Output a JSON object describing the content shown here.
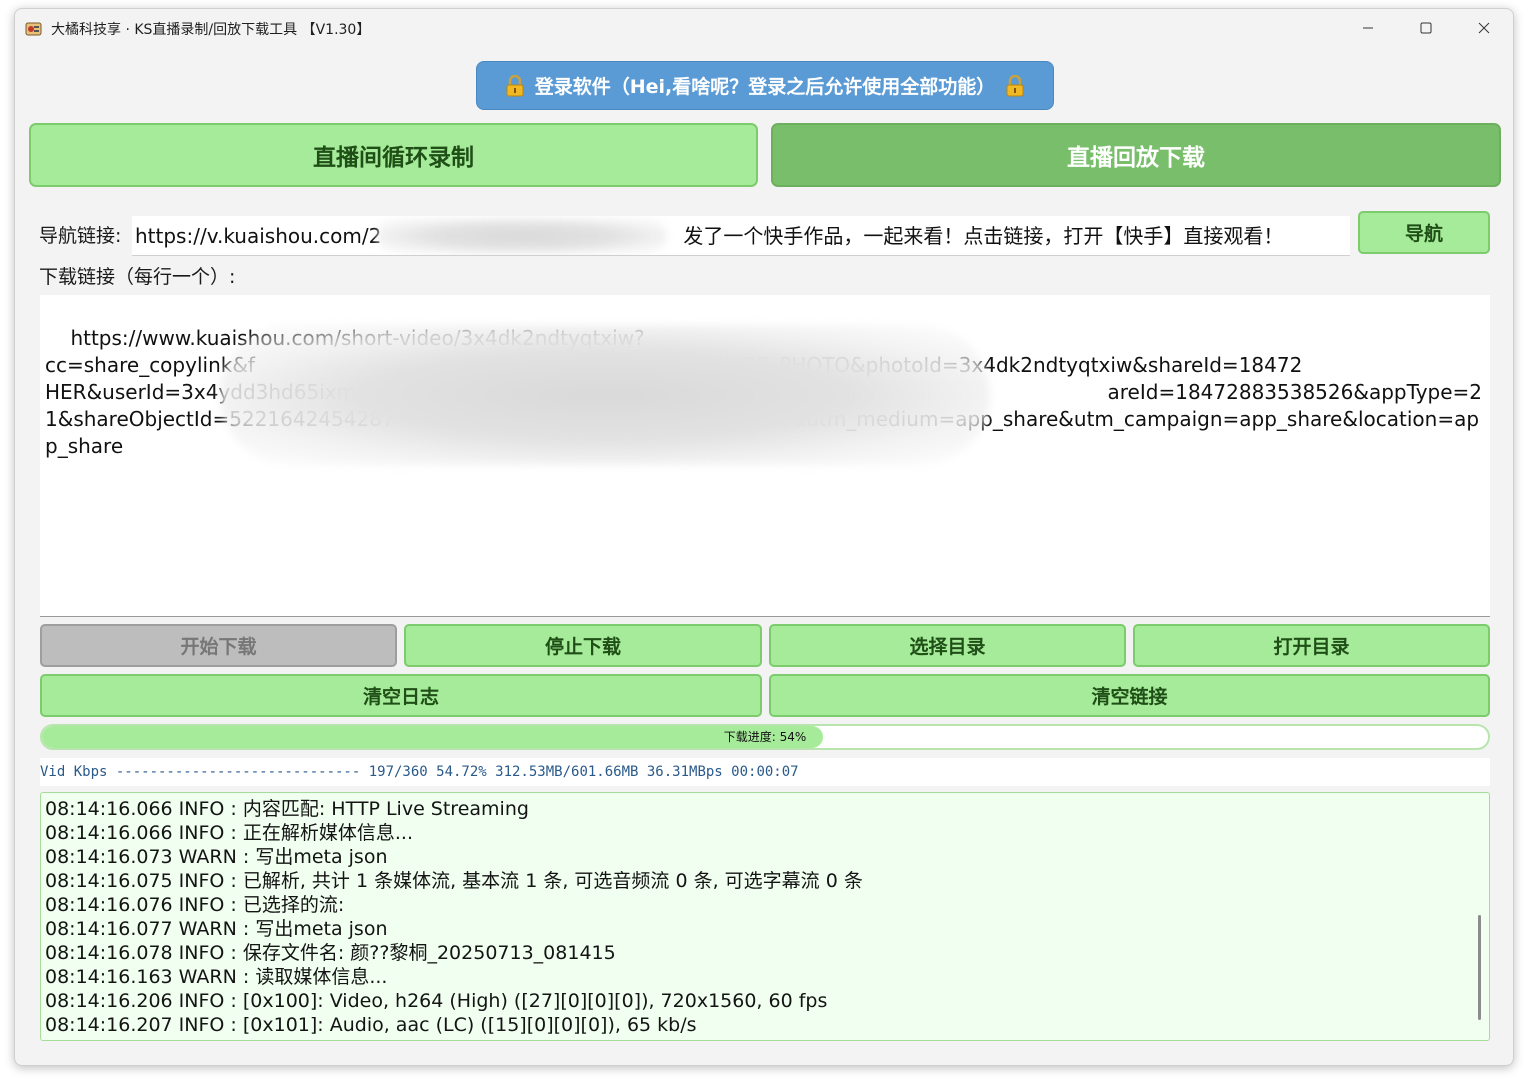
{
  "window": {
    "title": "大橘科技享 · KS直播录制/回放下载工具 【V1.30】"
  },
  "login": {
    "label": "登录软件（Hei,看啥呢？登录之后允许使用全部功能）"
  },
  "tabs": [
    {
      "label": "直播间循环录制"
    },
    {
      "label": "直播回放下载"
    }
  ],
  "nav": {
    "label": "导航链接:",
    "value_prefix": "https://v.kuaishou.com/2",
    "value_suffix": "发了一个快手作品，一起来看！点击链接，打开【快手】直接观看！",
    "button": "导航"
  },
  "download": {
    "label": "下载链接（每行一个）:",
    "links": "https://www.kuaishou.com/short-video/3x4dk2ndtyqtxiw?\ncc=share_copylink&f                                                 Biz=BROWSE_SLIDE_PHOTO&photoId=3x4dk2ndtyqtxiw&shareId=18472                                                   HER&userId=3x4ydd3hd65ixms&shareType=1&et=1_i%252F20047764 1                                                   areId=18472883538526&appType=21&shareObjectId=5221642454287                                                  p_share&utm_medium=app_share&utm_campaign=app_share&location=app_share"
  },
  "buttons": {
    "start": "开始下载",
    "stop": "停止下载",
    "choose_dir": "选择目录",
    "open_dir": "打开目录",
    "clear_log": "清空日志",
    "clear_links": "清空链接"
  },
  "progress": {
    "value": 54,
    "label": "下载进度: 54%"
  },
  "status_line": "Vid Kbps ----------------------------- 197/360 54.72% 312.53MB/601.66MB 36.31MBps 00:00:07",
  "log": {
    "lines": [
      "08:14:16.066 INFO : 内容匹配: HTTP Live Streaming",
      "08:14:16.066 INFO : 正在解析媒体信息...",
      "08:14:16.073 WARN : 写出meta json",
      "08:14:16.075 INFO : 已解析, 共计 1 条媒体流, 基本流 1 条, 可选音频流 0 条, 可选字幕流 0 条",
      "08:14:16.076 INFO : 已选择的流:",
      "08:14:16.077 WARN : 写出meta json",
      "08:14:16.078 INFO : 保存文件名: 颜??黎桐_20250713_081415",
      "08:14:16.163 WARN : 读取媒体信息...",
      "08:14:16.206 INFO : [0x100]: Video, h264 (High) ([27][0][0][0]), 720x1560, 60 fps",
      "08:14:16.207 INFO : [0x101]: Audio, aac (LC) ([15][0][0][0]), 65 kb/s"
    ]
  },
  "colors": {
    "green_button": "#a6eb99",
    "green_active_tab": "#79bf6b",
    "login_blue": "#5b9bd5",
    "log_background": "#f0fff0"
  }
}
